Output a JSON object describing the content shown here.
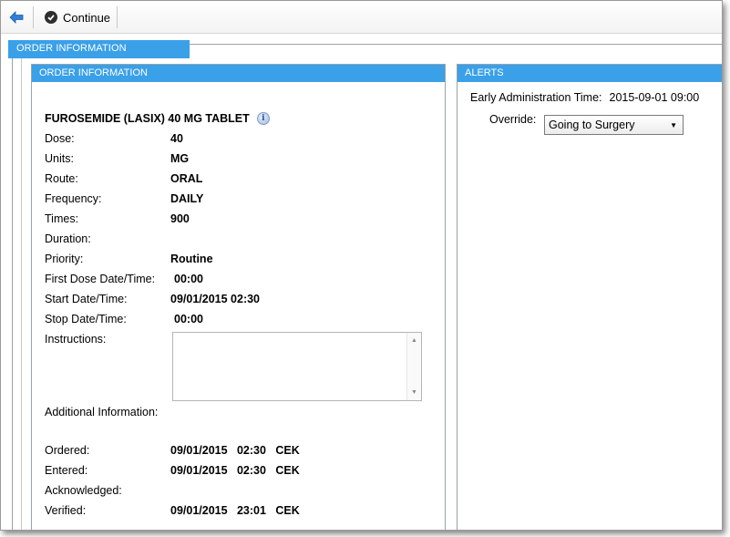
{
  "toolbar": {
    "back_icon": "back-arrow-icon",
    "continue_icon": "check-circle-icon",
    "continue_label": "Continue"
  },
  "outer_tab": {
    "label": "ORDER INFORMATION"
  },
  "order_panel": {
    "header": "ORDER INFORMATION",
    "drug_title": "FUROSEMIDE (LASIX) 40 MG TABLET",
    "info_icon": "info-icon",
    "fields": [
      {
        "label": "Dose:",
        "value": "40"
      },
      {
        "label": "Units:",
        "value": "MG"
      },
      {
        "label": "Route:",
        "value": "ORAL"
      },
      {
        "label": "Frequency:",
        "value": "DAILY"
      },
      {
        "label": "Times:",
        "value": "900"
      },
      {
        "label": "Duration:",
        "value": ""
      },
      {
        "label": "Priority:",
        "value": "Routine"
      },
      {
        "label": "First Dose Date/Time:",
        "value": "00:00"
      },
      {
        "label": "Start Date/Time:",
        "value": "09/01/2015 02:30"
      },
      {
        "label": "Stop Date/Time:",
        "value": "00:00"
      }
    ],
    "instructions_label": "Instructions:",
    "instructions_value": "",
    "additional_info_label": "Additional Information:",
    "audit": [
      {
        "label": "Ordered:",
        "value": "09/01/2015   02:30   CEK"
      },
      {
        "label": "Entered:",
        "value": "09/01/2015   02:30   CEK"
      },
      {
        "label": "Acknowledged:",
        "value": ""
      },
      {
        "label": "Verified:",
        "value": "09/01/2015   23:01   CEK"
      }
    ]
  },
  "alerts_panel": {
    "header": "ALERTS",
    "alert_label": "Early Administration Time:",
    "alert_value": "2015-09-01 09:00",
    "override_label": "Override:",
    "override_value": "Going to Surgery"
  },
  "colors": {
    "tab_blue": "#3aa0e8",
    "border_gray": "#9aa3ab"
  }
}
